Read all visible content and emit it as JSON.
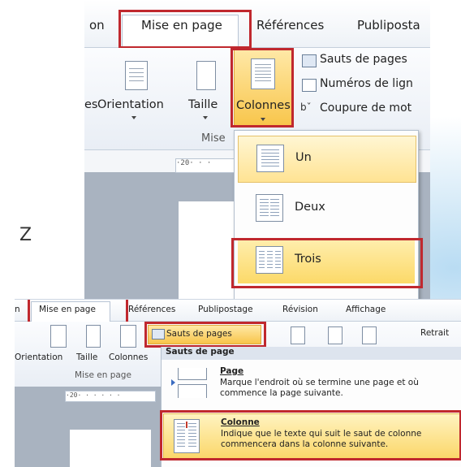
{
  "colors": {
    "highlight_box": "#c0282e",
    "hover_fill": "#fbd76a",
    "ribbon_bg": "#eef2f7"
  },
  "side_letter": "Z",
  "top_window": {
    "tabs": [
      {
        "label": "on",
        "active": false
      },
      {
        "label": "Mise en page",
        "active": true
      },
      {
        "label": "Références",
        "active": false
      },
      {
        "label": "Publiposta",
        "active": false
      }
    ],
    "ribbon": {
      "buttons": [
        {
          "label": "es",
          "icon": "margins-icon"
        },
        {
          "label": "Orientation",
          "icon": "orientation-icon"
        },
        {
          "label": "Taille",
          "icon": "size-icon"
        },
        {
          "label": "Colonnes",
          "icon": "columns-icon"
        }
      ],
      "small_buttons": [
        {
          "label": "Sauts de pages",
          "icon": "page-breaks-icon"
        },
        {
          "label": "Numéros de lign",
          "icon": "line-numbers-icon"
        },
        {
          "label": "Coupure de mot",
          "icon": "hyphenation-icon"
        }
      ],
      "group_label": "Mise",
      "ruler_text": "·20· · ·"
    },
    "columns_menu": [
      {
        "label": "Un",
        "columns": 1,
        "state": "selected"
      },
      {
        "label": "Deux",
        "columns": 2,
        "state": "normal"
      },
      {
        "label": "Trois",
        "columns": 3,
        "state": "hover"
      }
    ]
  },
  "bottom_window": {
    "tabs": [
      {
        "label": "n"
      },
      {
        "label": "Mise en page"
      },
      {
        "label": "Références"
      },
      {
        "label": "Publipostage"
      },
      {
        "label": "Révision"
      },
      {
        "label": "Affichage"
      }
    ],
    "ribbon": {
      "buttons": [
        {
          "label": "Orientation"
        },
        {
          "label": "Taille"
        },
        {
          "label": "Colonnes"
        }
      ],
      "breaks_button": "Sauts de pages",
      "retrait": "Retrait",
      "group_label": "Mise en page",
      "ruler_text": "·20· · · · · ·"
    },
    "breaks_menu": {
      "header": "Sauts de page",
      "items": [
        {
          "title": "Page",
          "description": "Marque l'endroit où se termine une page et où commence la page suivante.",
          "state": "normal"
        },
        {
          "title": "Colonne",
          "description": "Indique que le texte qui suit le saut de colonne commencera dans la colonne suivante.",
          "state": "hover"
        }
      ]
    }
  }
}
